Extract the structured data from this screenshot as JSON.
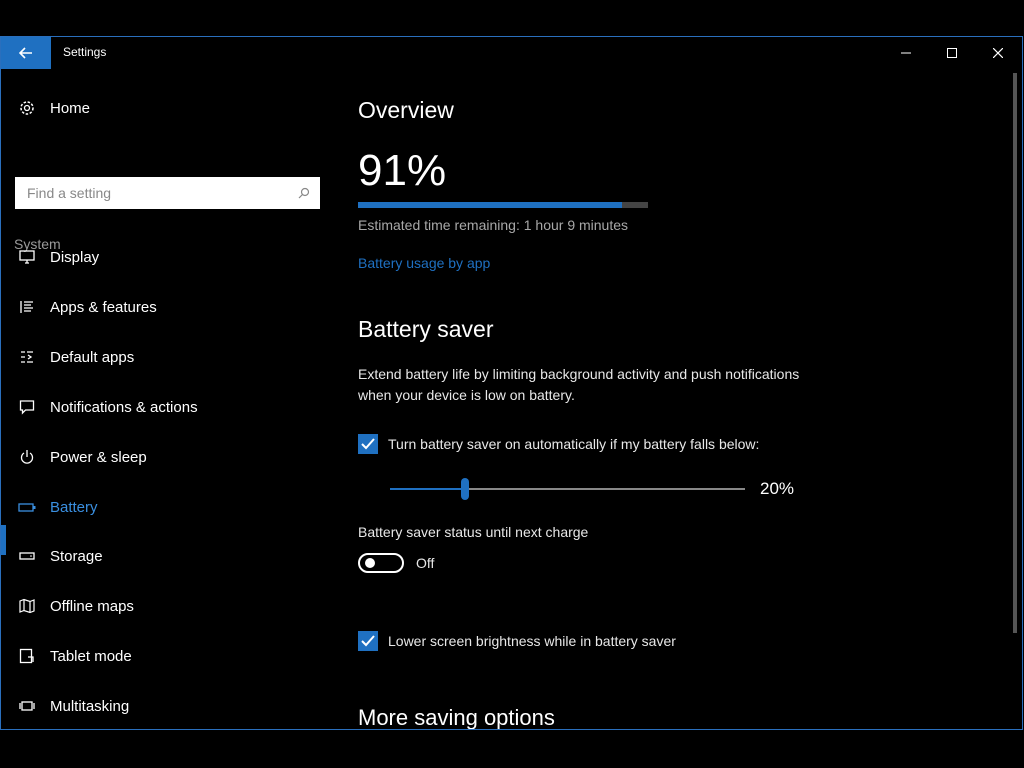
{
  "app": {
    "title": "Settings"
  },
  "sidebar": {
    "home_label": "Home",
    "search_placeholder": "Find a setting",
    "section_label": "System",
    "items": [
      {
        "label": "Display",
        "icon": "monitor-icon"
      },
      {
        "label": "Apps & features",
        "icon": "list-icon"
      },
      {
        "label": "Default apps",
        "icon": "default-apps-icon"
      },
      {
        "label": "Notifications & actions",
        "icon": "chat-bubble-icon"
      },
      {
        "label": "Power & sleep",
        "icon": "power-icon"
      },
      {
        "label": "Battery",
        "icon": "battery-icon",
        "active": true
      },
      {
        "label": "Storage",
        "icon": "storage-icon"
      },
      {
        "label": "Offline maps",
        "icon": "map-icon"
      },
      {
        "label": "Tablet mode",
        "icon": "tablet-icon"
      },
      {
        "label": "Multitasking",
        "icon": "multitasking-icon"
      }
    ]
  },
  "main": {
    "overview_heading": "Overview",
    "battery_percent": "91%",
    "battery_level": 0.91,
    "estimate": "Estimated time remaining: 1 hour 9 minutes",
    "usage_link": "Battery usage by app",
    "saver_heading": "Battery saver",
    "saver_desc": "Extend battery life by limiting background activity and push notifications when your device is low on battery.",
    "auto_label": "Turn battery saver on automatically if my battery falls below:",
    "auto_checked": true,
    "threshold_value": "20%",
    "threshold_fraction": 0.2,
    "status_label": "Battery saver status until next charge",
    "toggle_state": "Off",
    "brightness_label": "Lower screen brightness while in battery saver",
    "brightness_checked": true,
    "more_heading": "More saving options"
  },
  "colors": {
    "accent": "#1f70c1",
    "background": "#000000"
  }
}
